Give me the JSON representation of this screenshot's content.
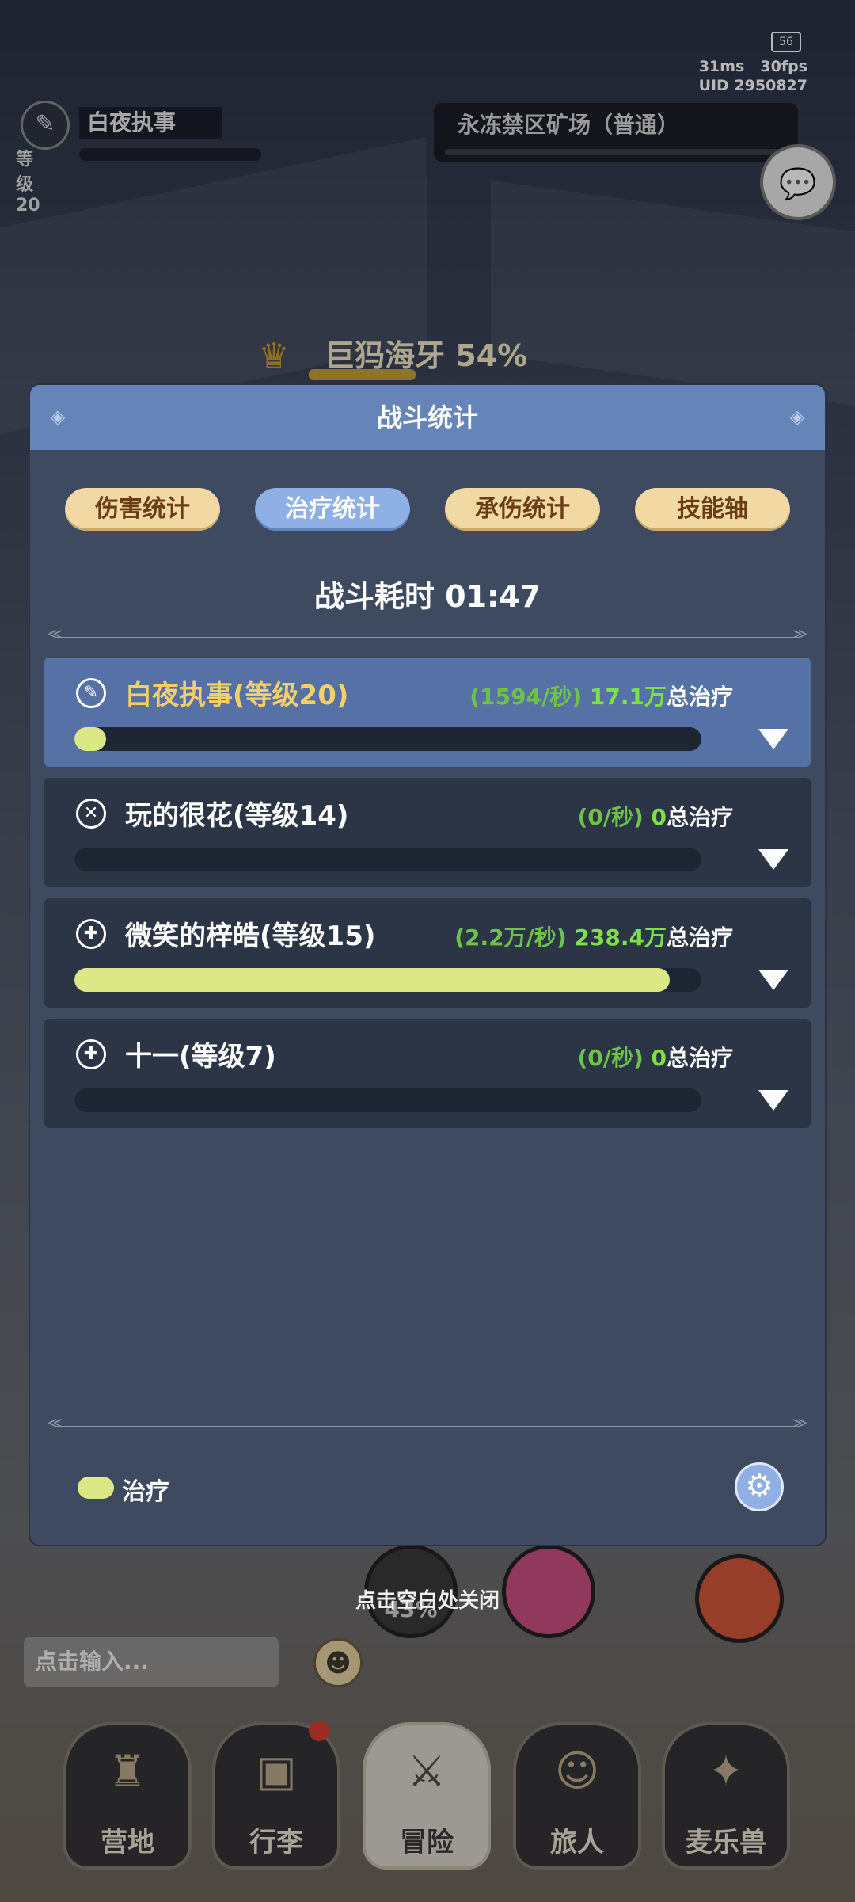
{
  "status": {
    "battery": "56",
    "ping": "31ms",
    "fps": "30fps",
    "uid": "UID 2950827"
  },
  "player": {
    "name": "白夜执事",
    "level": "等级20"
  },
  "zone": {
    "name": "永冻禁区矿场（普通）"
  },
  "boss": {
    "name": "巨犸海牙",
    "hp_percent": "54%",
    "hp_fraction": 0.54
  },
  "panel": {
    "title": "战斗统计",
    "tabs": [
      {
        "label": "伤害统计",
        "active": false
      },
      {
        "label": "治疗统计",
        "active": true
      },
      {
        "label": "承伤统计",
        "active": false
      },
      {
        "label": "技能轴",
        "active": false
      }
    ],
    "duration_label": "战斗耗时",
    "duration_value": "01:47",
    "entries": [
      {
        "name": "白夜执事(等级20)",
        "rate": "(1594/秒)",
        "total": "17.1万",
        "total_label": "总治疗",
        "fill": 0.05,
        "icon": "wand-icon",
        "selected": true
      },
      {
        "name": "玩的很花(等级14)",
        "rate": "(0/秒)",
        "total": "0",
        "total_label": "总治疗",
        "fill": 0,
        "icon": "crossed-swords-icon",
        "selected": false
      },
      {
        "name": "微笑的梓皓(等级15)",
        "rate": "(2.2万/秒)",
        "total": "238.4万",
        "total_label": "总治疗",
        "fill": 0.95,
        "icon": "cross-shield-icon",
        "selected": false
      },
      {
        "name": "十一(等级7)",
        "rate": "(0/秒)",
        "total": "0",
        "total_label": "总治疗",
        "fill": 0,
        "icon": "cross-shield-icon",
        "selected": false
      }
    ],
    "legend_label": "治疗",
    "legend_color": "#dbe885"
  },
  "close_hint": "点击空白处关闭",
  "chat_input": {
    "placeholder": "点击输入..."
  },
  "skill_percent": "43%",
  "nav": [
    {
      "label": "营地",
      "icon": "castle-icon"
    },
    {
      "label": "行李",
      "icon": "chest-icon",
      "badge": true
    },
    {
      "label": "冒险",
      "icon": "swords-icon",
      "active": true
    },
    {
      "label": "旅人",
      "icon": "hero-icon"
    },
    {
      "label": "麦乐兽",
      "icon": "fox-icon"
    }
  ]
}
